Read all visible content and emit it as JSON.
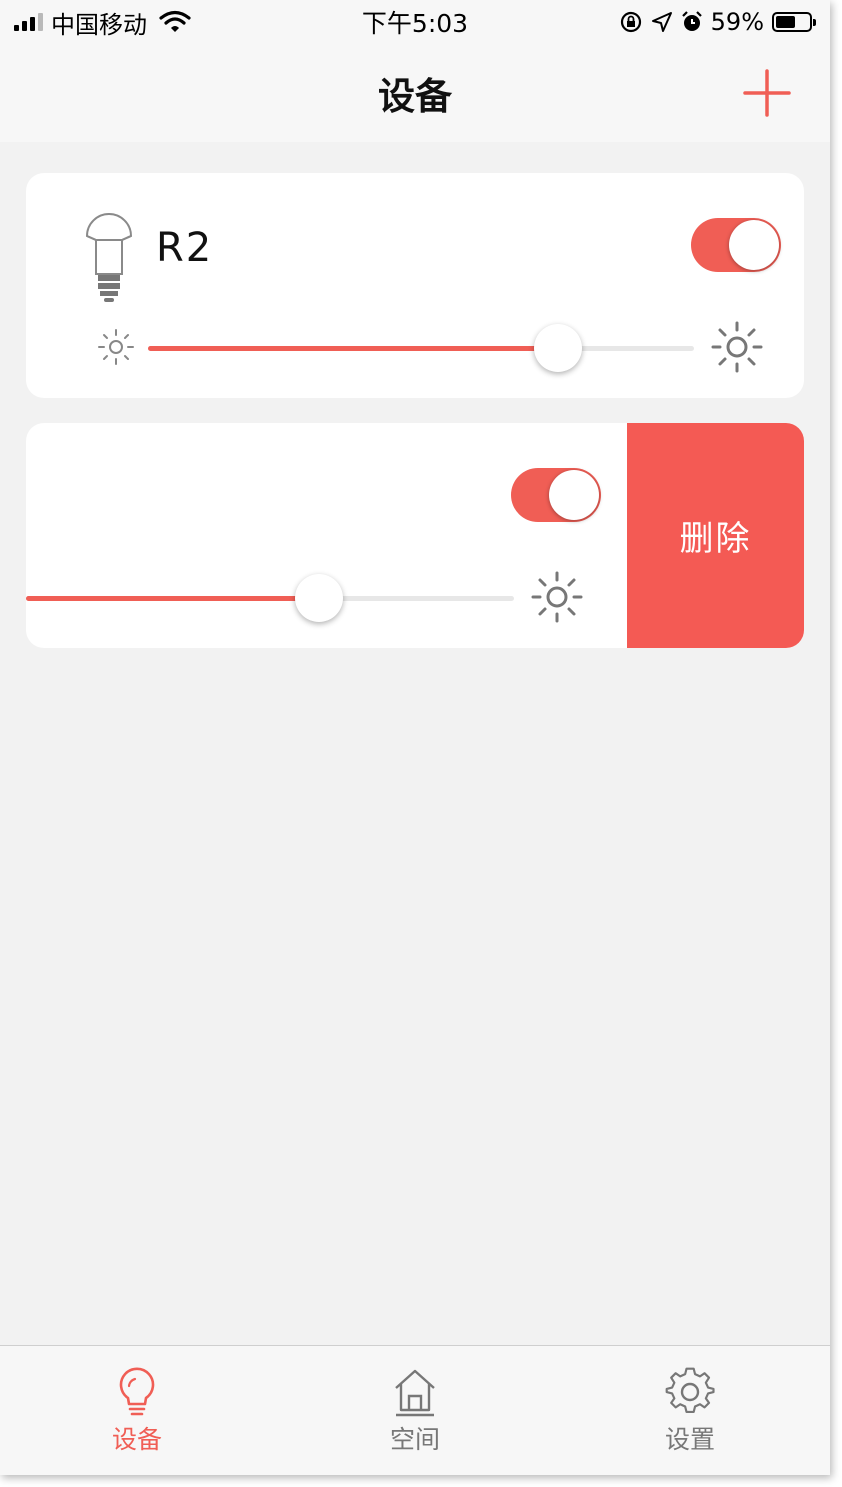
{
  "status_bar": {
    "carrier": "中国移动",
    "time": "下午5:03",
    "battery_percent": "59%",
    "battery_level": 0.59
  },
  "nav": {
    "title": "设备",
    "add_icon": "plus-icon"
  },
  "devices": [
    {
      "name": "R2",
      "icon": "light-bulb-icon",
      "power_on": true,
      "brightness": 0.75
    },
    {
      "name": "",
      "power_on": true,
      "brightness": 0.6,
      "swiped_open": true,
      "delete_label": "删除"
    }
  ],
  "tabs": [
    {
      "label": "设备",
      "icon": "bulb-icon",
      "active": true
    },
    {
      "label": "空间",
      "icon": "home-icon",
      "active": false
    },
    {
      "label": "设置",
      "icon": "gear-icon",
      "active": false
    }
  ],
  "colors": {
    "accent": "#f05e55",
    "delete": "#f45a54",
    "background": "#f2f2f2",
    "inactive_tab": "#777777"
  }
}
